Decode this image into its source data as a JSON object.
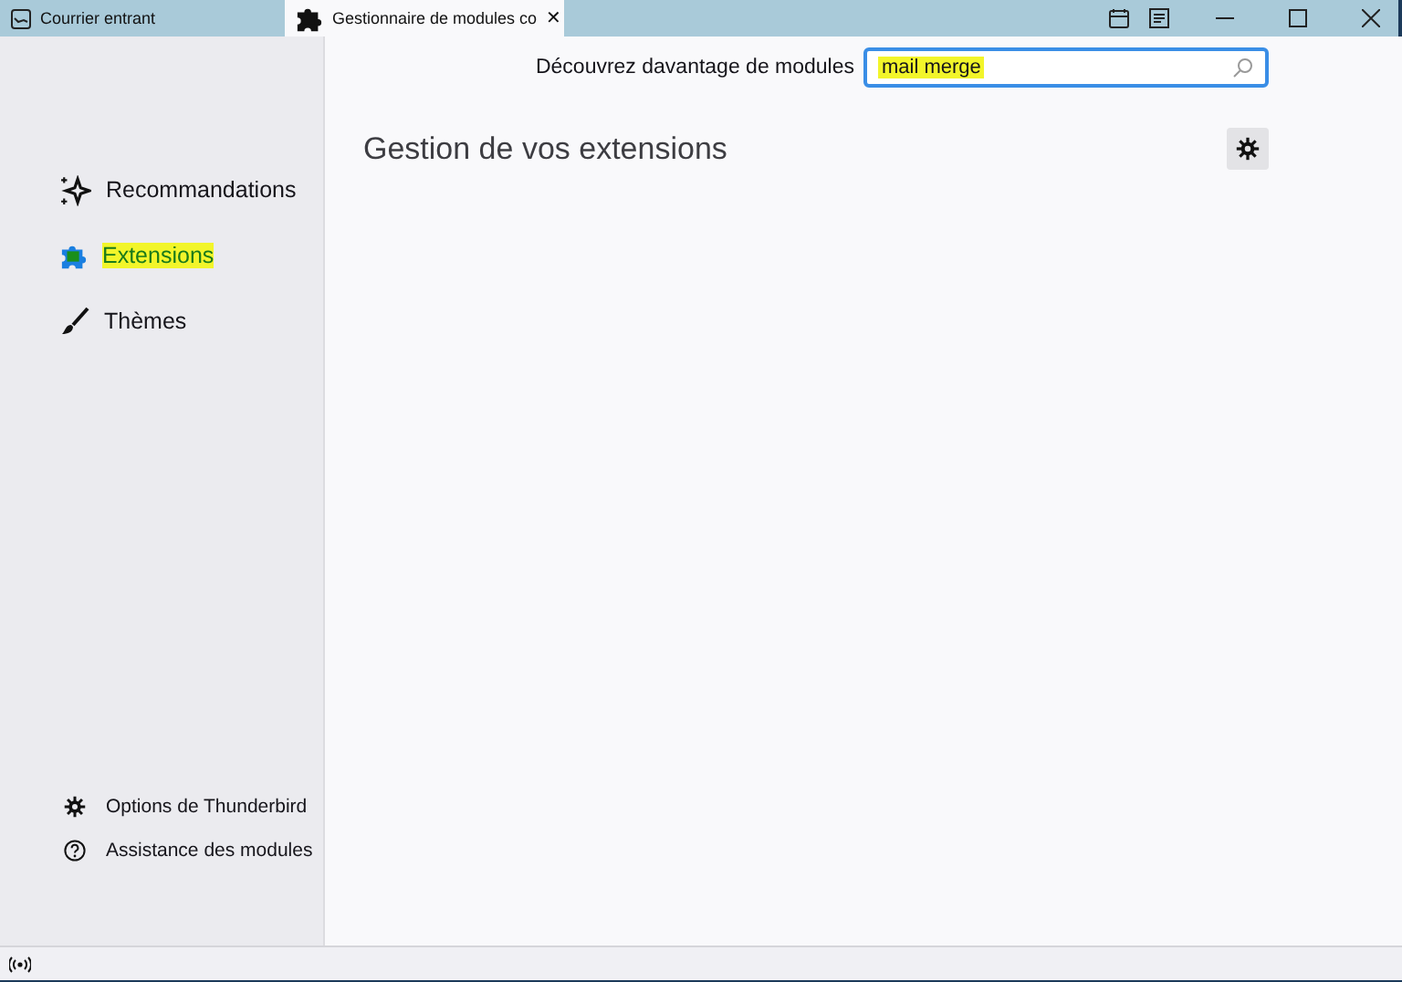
{
  "tabs": [
    {
      "label": "Courrier entrant",
      "selected": false
    },
    {
      "label": "Gestionnaire de modules co",
      "selected": true
    }
  ],
  "close_glyph": "✕",
  "search": {
    "label": "Découvrez davantage de modules",
    "value": "mail merge"
  },
  "heading": "Gestion de vos extensions",
  "sidebar": {
    "items": [
      {
        "label": "Recommandations",
        "selected": false
      },
      {
        "label": "Extensions",
        "selected": true
      },
      {
        "label": "Thèmes",
        "selected": false
      }
    ],
    "footer": [
      {
        "label": "Options de Thunderbird"
      },
      {
        "label": "Assistance des modules"
      }
    ]
  }
}
